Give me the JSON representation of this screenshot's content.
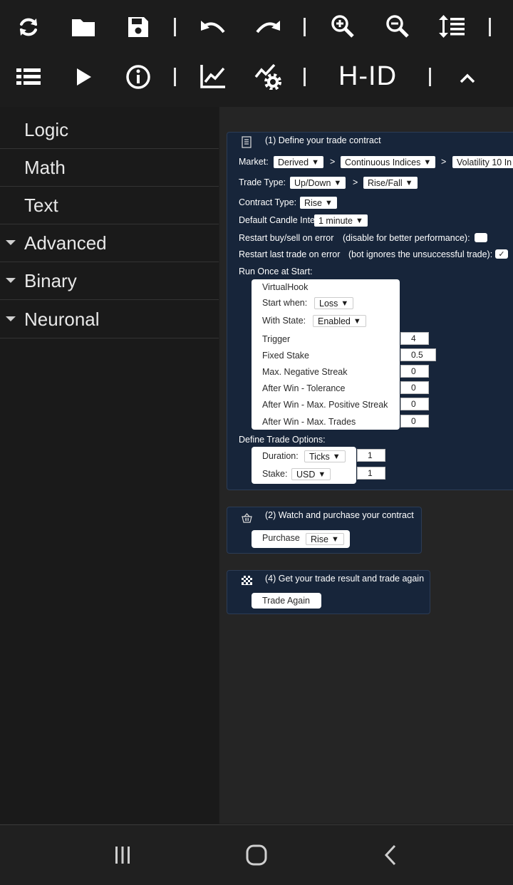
{
  "toolbar": {
    "row1": [
      "refresh-icon",
      "folder-open-icon",
      "save-icon",
      "undo-icon",
      "redo-icon",
      "zoom-in-icon",
      "zoom-out-icon",
      "sort-lines-icon"
    ],
    "row2": [
      "list-icon",
      "play-icon",
      "info-icon",
      "chart-icon",
      "chart-settings-icon"
    ],
    "hid_label": "H-ID",
    "collapse_icon": "chevron-up-icon"
  },
  "sidebar": {
    "categories": [
      {
        "label": "Logic",
        "expandable": false
      },
      {
        "label": "Math",
        "expandable": false
      },
      {
        "label": "Text",
        "expandable": false
      },
      {
        "label": "Advanced",
        "expandable": true
      },
      {
        "label": "Binary",
        "expandable": true
      },
      {
        "label": "Neuronal",
        "expandable": true
      }
    ]
  },
  "block1": {
    "title": "(1) Define your trade contract",
    "market_label": "Market:",
    "market": "Derived",
    "submarket": "Continuous Indices",
    "symbol": "Volatility 10 In",
    "gt": ">",
    "trade_type_label": "Trade Type:",
    "trade_type": "Up/Down",
    "trade_subtype": "Rise/Fall",
    "contract_type_label": "Contract Type:",
    "contract_type": "Rise",
    "candle_label": "Default Candle Interval:",
    "candle": "1 minute",
    "restart_error_label": "Restart buy/sell on error",
    "restart_error_note": "(disable for better performance):",
    "restart_last_label": "Restart last trade on error",
    "restart_last_note": "(bot ignores the unsuccessful trade):",
    "restart_last_check": "✓",
    "run_once_label": "Run Once at Start:",
    "define_options_label": "Define Trade Options:"
  },
  "virtualhook": {
    "title": "VirtualHook",
    "start_when_label": "Start when:",
    "start_when": "Loss",
    "with_state_label": "With State:",
    "with_state": "Enabled",
    "fields": [
      {
        "label": "Trigger",
        "value": "4"
      },
      {
        "label": "Fixed Stake",
        "value": "0.5"
      },
      {
        "label": "Max. Negative Streak",
        "value": "0"
      },
      {
        "label": "After Win - Tolerance",
        "value": "0"
      },
      {
        "label": "After Win - Max. Positive Streak",
        "value": "0"
      },
      {
        "label": "After Win - Max. Trades",
        "value": "0"
      }
    ]
  },
  "trade_options": {
    "duration_label": "Duration:",
    "duration_unit": "Ticks",
    "duration_value": "1",
    "stake_label": "Stake:",
    "currency": "USD",
    "stake_value": "1"
  },
  "block2": {
    "title": "(2) Watch and purchase your contract",
    "purchase_label": "Purchase",
    "purchase_value": "Rise"
  },
  "block4": {
    "title": "(4) Get your trade result and trade again",
    "trade_again_label": "Trade Again"
  },
  "dropdown_arrow": "▼",
  "navbar": [
    "recent-apps-icon",
    "home-icon",
    "back-icon"
  ]
}
